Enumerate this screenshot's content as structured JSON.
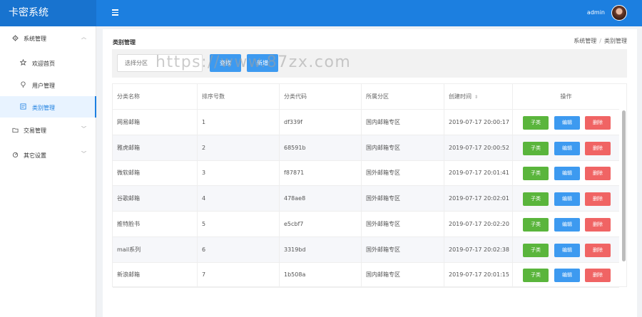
{
  "app": {
    "title": "卡密系统",
    "user": "admin"
  },
  "sidebar": {
    "items": [
      {
        "label": "系统管理",
        "icon": "gear-icon",
        "expanded": true
      },
      {
        "label": "交易管理",
        "icon": "folder-icon",
        "expanded": false
      },
      {
        "label": "其它设置",
        "icon": "circle-icon",
        "expanded": false
      }
    ],
    "subitems": [
      {
        "label": "欢迎首页",
        "icon": "star-icon"
      },
      {
        "label": "用户管理",
        "icon": "bulb-icon"
      },
      {
        "label": "类别管理",
        "icon": "image-icon",
        "active": true
      }
    ]
  },
  "page": {
    "title": "类别管理",
    "breadcrumb": [
      "系统管理",
      "类别管理"
    ]
  },
  "toolbar": {
    "search_placeholder": "选择分区",
    "find_label": "查找",
    "add_label": "新增"
  },
  "watermark": "https://www.87zx.com",
  "table": {
    "headers": [
      "分类名称",
      "排序号数",
      "分类代码",
      "所属分区",
      "创建时间",
      "操作"
    ],
    "action_labels": {
      "child": "子类",
      "edit": "编辑",
      "delete": "删除"
    },
    "rows": [
      {
        "name": "网易邮箱",
        "order": "1",
        "code": "df339f",
        "zone": "国内邮箱专区",
        "time": "2019-07-17 20:00:17"
      },
      {
        "name": "雅虎邮箱",
        "order": "2",
        "code": "68591b",
        "zone": "国内邮箱专区",
        "time": "2019-07-17 20:00:52"
      },
      {
        "name": "微软邮箱",
        "order": "3",
        "code": "f87871",
        "zone": "国外邮箱专区",
        "time": "2019-07-17 20:01:41"
      },
      {
        "name": "谷歌邮箱",
        "order": "4",
        "code": "478ae8",
        "zone": "国外邮箱专区",
        "time": "2019-07-17 20:02:01"
      },
      {
        "name": "推特脸书",
        "order": "5",
        "code": "e5cbf7",
        "zone": "国外邮箱专区",
        "time": "2019-07-17 20:02:20"
      },
      {
        "name": "mail系列",
        "order": "6",
        "code": "3319bd",
        "zone": "国外邮箱专区",
        "time": "2019-07-17 20:02:38"
      },
      {
        "name": "新浪邮箱",
        "order": "7",
        "code": "1b508a",
        "zone": "国内邮箱专区",
        "time": "2019-07-17 20:01:15"
      }
    ]
  },
  "colors": {
    "primary": "#1c7fe0",
    "green": "#5ab53c",
    "blue": "#3d9af0",
    "red": "#f06464"
  }
}
